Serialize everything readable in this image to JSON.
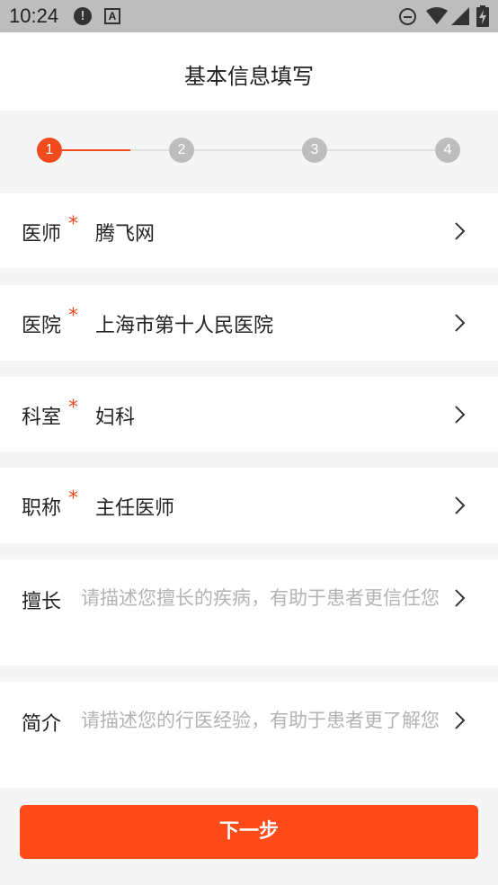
{
  "status_bar": {
    "time": "10:24",
    "a_icon_letter": "A",
    "alert_icon_glyph": "!"
  },
  "header": {
    "title": "基本信息填写"
  },
  "stepper": {
    "steps": [
      {
        "label": "1"
      },
      {
        "label": "2"
      },
      {
        "label": "3"
      },
      {
        "label": "4"
      }
    ],
    "active_step": 1,
    "active_color": "#f04a1d",
    "inactive_color": "#bdbdbd"
  },
  "form": {
    "required_mark": "*",
    "fields": [
      {
        "label": "医师",
        "value": "腾飞网"
      },
      {
        "label": "医院",
        "value": "上海市第十人民医院"
      },
      {
        "label": "科室",
        "value": "妇科"
      },
      {
        "label": "职称",
        "value": "主任医师"
      },
      {
        "label": "擅长",
        "placeholder": "请描述您擅长的疾病，有助于患者更信任您"
      },
      {
        "label": "简介",
        "placeholder": "请描述您的行医经验，有助于患者更了解您"
      }
    ]
  },
  "footer": {
    "next_label": "下一步",
    "button_color": "#ff4a1a"
  }
}
